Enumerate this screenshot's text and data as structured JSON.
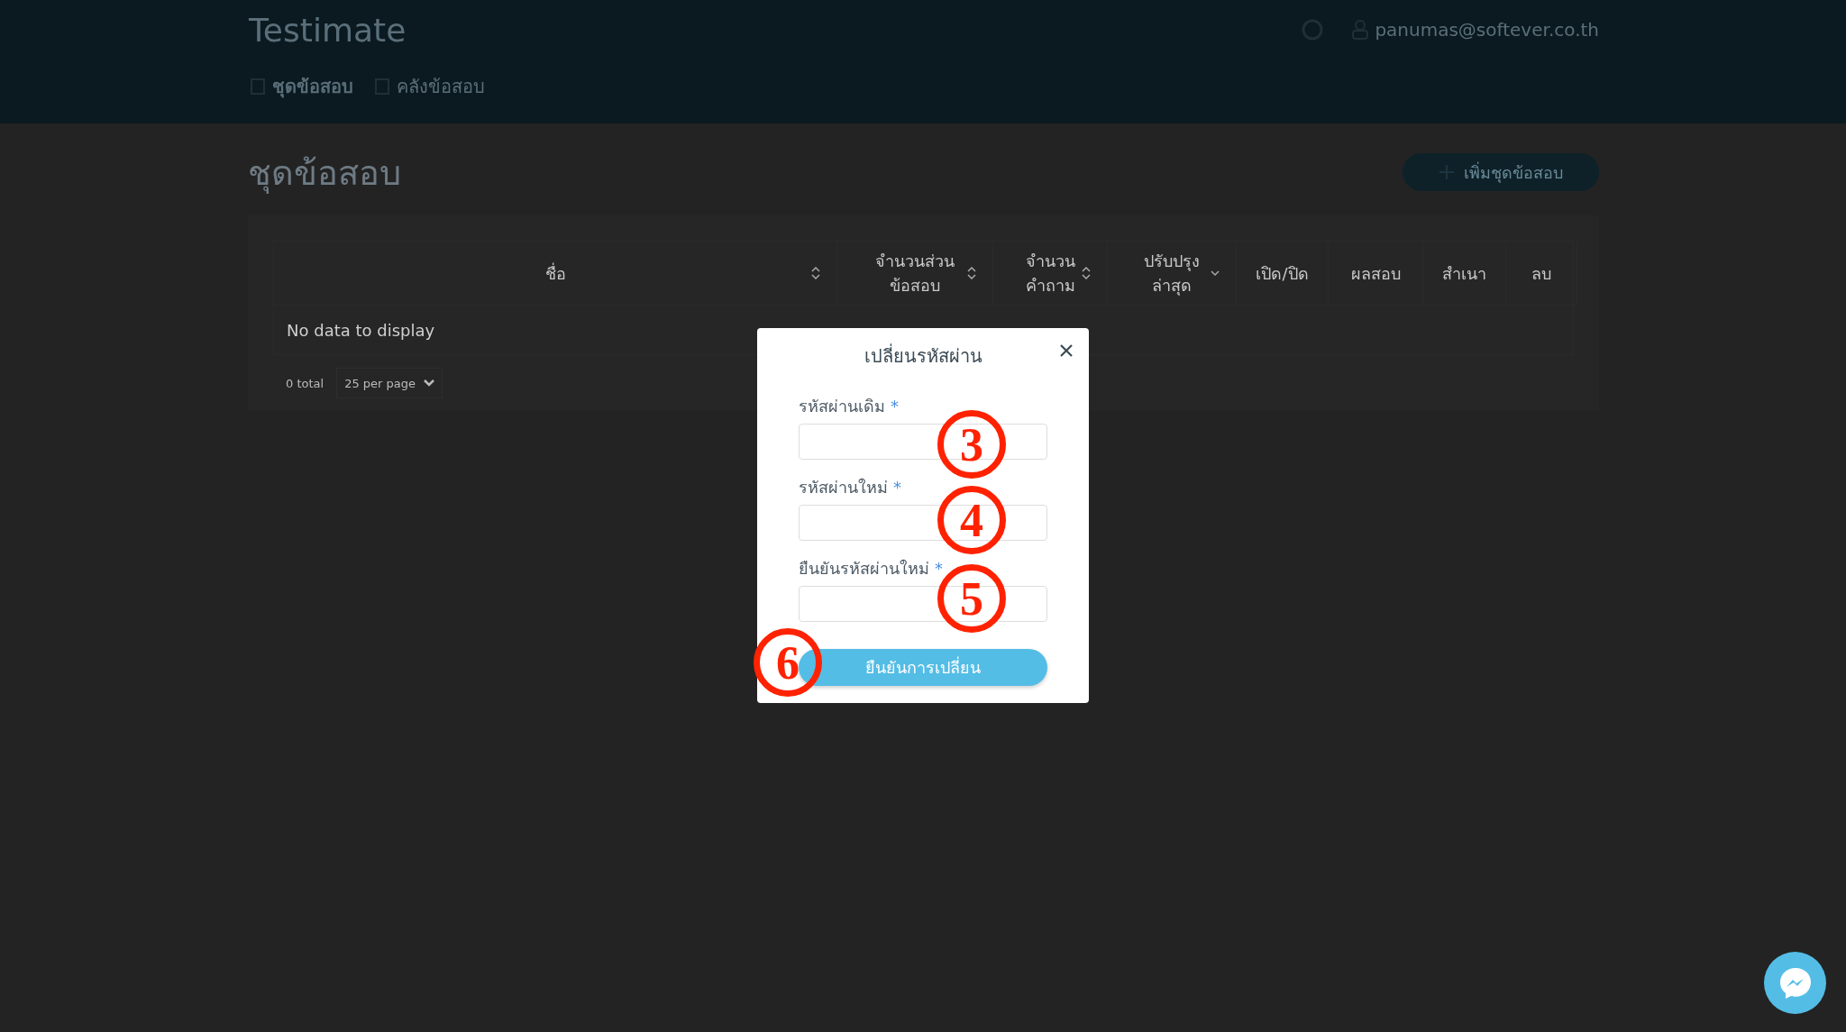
{
  "header": {
    "logo": "Testimate",
    "user_email": "panumas@softever.co.th",
    "nav": [
      {
        "label": "ชุดข้อสอบ",
        "selected": true
      },
      {
        "label": "คลังข้อสอบ",
        "selected": false
      }
    ]
  },
  "page": {
    "title": "ชุดข้อสอบ",
    "add_button": "เพิ่มชุดข้อสอบ"
  },
  "table": {
    "columns": [
      {
        "label": "ชื่อ",
        "kind": "sortable"
      },
      {
        "label": "จำนวนส่วน ข้อสอบ",
        "kind": "sortable"
      },
      {
        "label": "จำนวน คำถาม",
        "kind": "sortable"
      },
      {
        "label": "ปรับปรุง ล่าสุด",
        "kind": "sorted"
      },
      {
        "label": "เปิด/ปิด",
        "kind": "plain"
      },
      {
        "label": "ผลสอบ",
        "kind": "plain"
      },
      {
        "label": "สำเนา",
        "kind": "plain"
      },
      {
        "label": "ลบ",
        "kind": "plain"
      }
    ],
    "empty_text": "No data to display",
    "total": "0 total",
    "per_page": "25 per page"
  },
  "dialog": {
    "title": "เปลี่ยนรหัสผ่าน",
    "fields": [
      {
        "label": "รหัสผ่านเดิม",
        "required_mark": "*"
      },
      {
        "label": "รหัสผ่านใหม่",
        "required_mark": "*"
      },
      {
        "label": "ยืนยันรหัสผ่านใหม่",
        "required_mark": "*"
      }
    ],
    "submit": "ยืนยันการเปลี่ยน"
  },
  "annotations": [
    "3",
    "4",
    "5",
    "6"
  ]
}
